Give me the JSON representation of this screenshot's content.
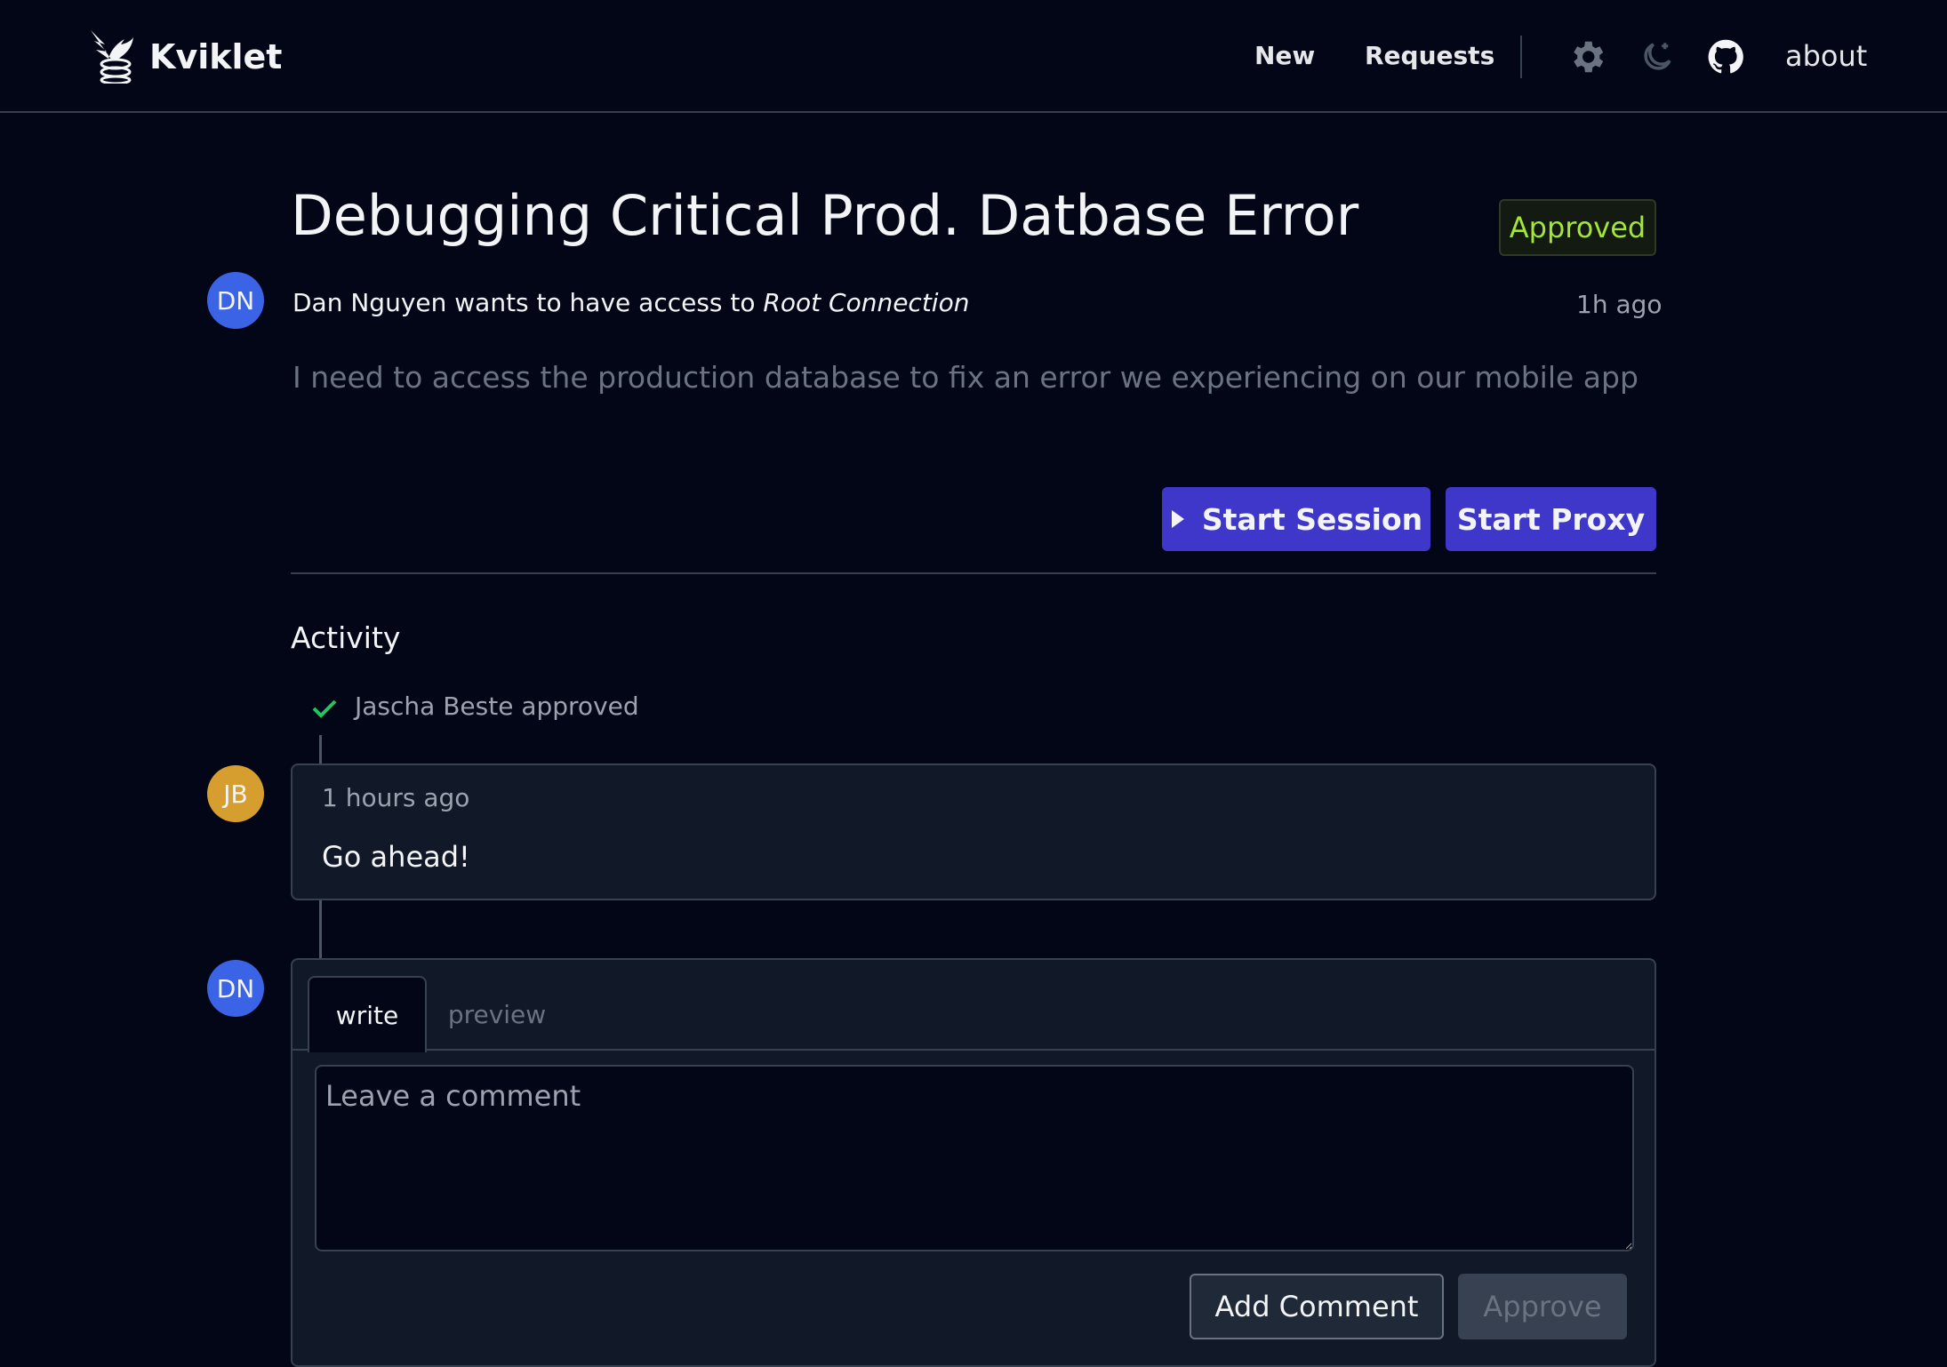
{
  "header": {
    "brand": "Kviklet",
    "nav": {
      "new_label": "New",
      "requests_label": "Requests",
      "about_label": "about"
    },
    "icons": [
      "logo-bird-icon",
      "gear-icon",
      "moon-icon",
      "github-icon"
    ]
  },
  "request": {
    "title": "Debugging Critical Prod. Datbase Error",
    "status": "Approved",
    "requester_initials": "DN",
    "requester_text": "Dan Nguyen wants to have access to ",
    "connection": "Root Connection",
    "time_ago": "1h ago",
    "description": "I need to access the production database to fix an error we experiencing on our mobile app",
    "start_session_label": "Start Session",
    "start_proxy_label": "Start Proxy"
  },
  "activity": {
    "title": "Activity",
    "events": [
      {
        "type": "approval",
        "text": "Jascha Beste approved"
      }
    ],
    "comments": [
      {
        "initials": "JB",
        "time": "1 hours ago",
        "body": "Go ahead!"
      }
    ]
  },
  "editor": {
    "initials": "DN",
    "tabs": [
      "write",
      "preview"
    ],
    "placeholder": "Leave a comment",
    "add_comment_label": "Add Comment",
    "approve_label": "Approve"
  },
  "colors": {
    "background": "#030616",
    "primary_button": "#3f37c9",
    "approved_badge_text": "#a3e635",
    "avatar_dn": "#3b63e5",
    "avatar_jb": "#d69e2e",
    "check": "#22c55e"
  }
}
